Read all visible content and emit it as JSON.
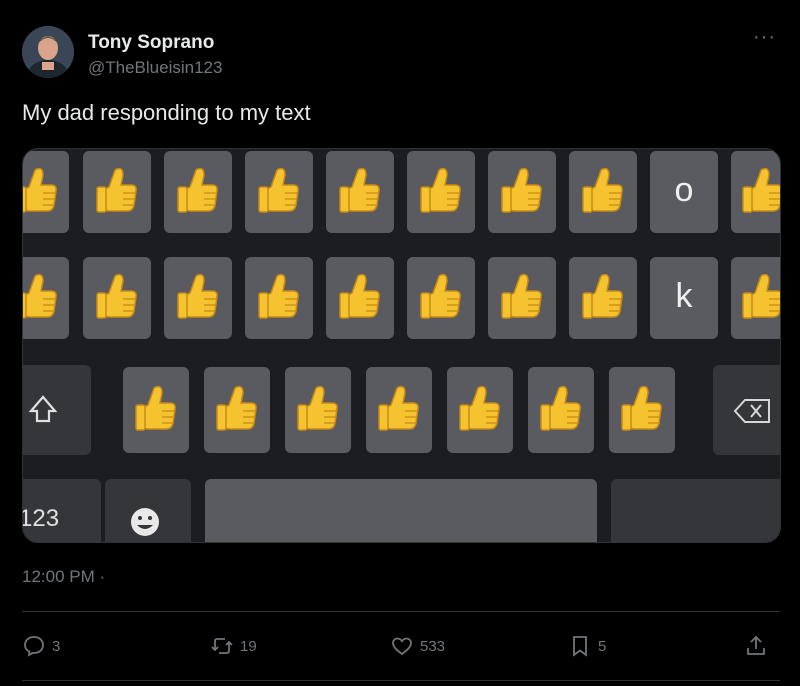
{
  "author": {
    "name": "Tony Soprano",
    "handle": "@TheBlueisin123"
  },
  "tweet": {
    "text": "My dad responding to my text",
    "timestamp": "12:00 PM ·"
  },
  "media": {
    "keyboard": {
      "row1_letter": "o",
      "row2_letter": "k",
      "numbers_key": "123",
      "key_emoji": "👍",
      "emoji_key_icon": "smiling-face-icon",
      "shift_key_icon": "shift-arrow-icon",
      "backspace_key_icon": "backspace-icon"
    }
  },
  "actions": {
    "replies": "3",
    "retweets": "19",
    "likes": "533",
    "bookmarks": "5"
  },
  "colors": {
    "background": "#000000",
    "text": "#e7e9ea",
    "muted": "#71767b",
    "key": "#5a5b60",
    "key_dark": "#35363a",
    "keyboard_bg": "#1c1d20"
  }
}
